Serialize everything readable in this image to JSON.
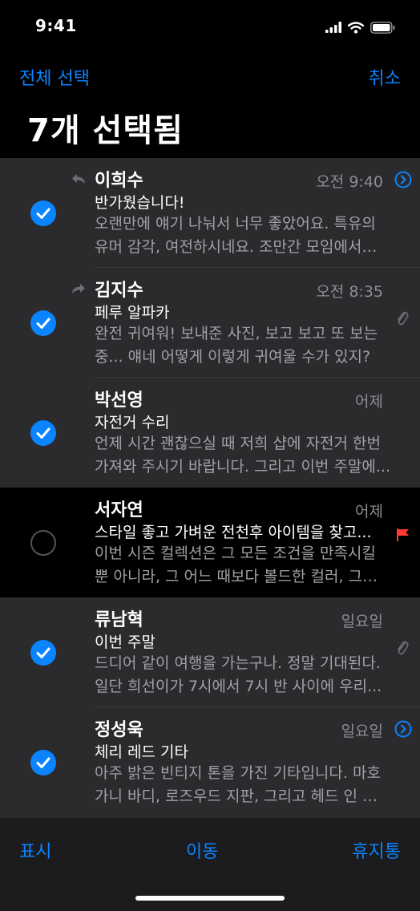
{
  "status": {
    "time": "9:41"
  },
  "nav": {
    "select_all": "전체 선택",
    "cancel": "취소"
  },
  "title": "7개 선택됨",
  "mails": [
    {
      "sender": "이희수",
      "date": "오전 9:40",
      "subject": "반가웠습니다!",
      "preview": "오랜만에 얘기 나눠서 너무 좋았어요. 특유의 유머 감각, 여전하시네요. 조만간 모임에서 또...",
      "selected": true,
      "status_icon": "reply-arrow-icon",
      "trailing": "chevron"
    },
    {
      "sender": "김지수",
      "date": "오전 8:35",
      "subject": "페루 알파카",
      "preview": "완전 귀여워! 보내준 사진, 보고 보고 또 보는 중... 얘네 어떻게 이렇게 귀여울 수가 있지?",
      "selected": true,
      "status_icon": "forward-arrow-icon",
      "trailing": "attachment"
    },
    {
      "sender": "박선영",
      "date": "어제",
      "subject": "자전거 수리",
      "preview": "언제 시간 괜찮으실 때 저희 샵에 자전거 한번 가져와 주시기 바랍니다. 그리고 이번 주말에...",
      "selected": true,
      "status_icon": "",
      "trailing": ""
    },
    {
      "sender": "서자연",
      "date": "어제",
      "subject": "스타일 좋고 가벼운 전천후 아이템을 찾고...",
      "preview": "이번 시즌 컬렉션은 그 모든 조건을 만족시킬 뿐 아니라, 그 어느 때보다 볼드한 컬러, 그리고...",
      "selected": false,
      "status_icon": "",
      "trailing": "flag"
    },
    {
      "sender": "류남혁",
      "date": "일요일",
      "subject": "이번 주말",
      "preview": "드디어 같이 여행을 가는구나. 정말 기대된다. 일단 희선이가 7시에서 7시 반 사이에 우리...",
      "selected": true,
      "status_icon": "",
      "trailing": "attachment"
    },
    {
      "sender": "정성욱",
      "date": "일요일",
      "subject": "체리 레드 기타",
      "preview": "아주 밝은 빈티지 톤을 가진 기타입니다. 마호가니 바디, 로즈우드 지판, 그리고 헤드 인 레이...",
      "selected": true,
      "status_icon": "",
      "trailing": "chevron"
    }
  ],
  "toolbar": {
    "mark": "표시",
    "move": "이동",
    "trash": "휴지통"
  },
  "colors": {
    "accent": "#0a84ff",
    "selected_row": "#2b2b2d",
    "flag": "#ff3b30"
  }
}
